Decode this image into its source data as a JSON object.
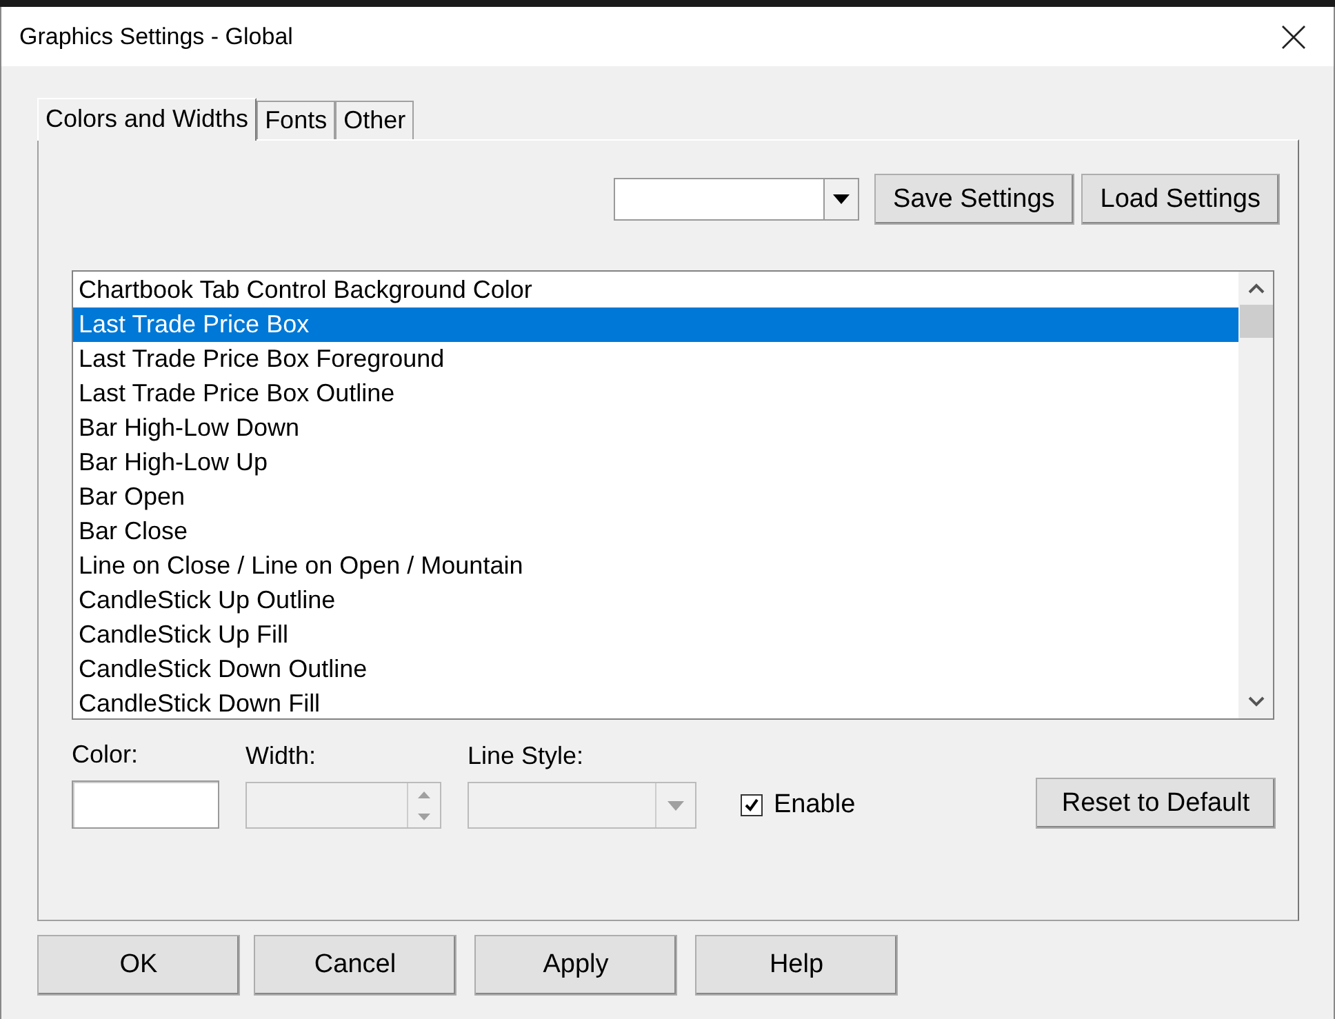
{
  "window": {
    "title": "Graphics Settings - Global"
  },
  "tabs": [
    {
      "label": "Colors and Widths",
      "selected": true
    },
    {
      "label": "Fonts",
      "selected": false
    },
    {
      "label": "Other",
      "selected": false
    }
  ],
  "settings_buttons": [
    "Save Settings",
    "Load Settings"
  ],
  "items": [
    {
      "label": "Chartbook Tab Control Background Color",
      "selected": false
    },
    {
      "label": "Last Trade Price Box",
      "selected": true
    },
    {
      "label": "Last Trade Price Box Foreground",
      "selected": false
    },
    {
      "label": "Last Trade Price Box Outline",
      "selected": false
    },
    {
      "label": "Bar High-Low Down",
      "selected": false
    },
    {
      "label": "Bar High-Low Up",
      "selected": false
    },
    {
      "label": "Bar Open",
      "selected": false
    },
    {
      "label": "Bar Close",
      "selected": false
    },
    {
      "label": "Line on Close / Line on Open / Mountain",
      "selected": false
    },
    {
      "label": "CandleStick Up Outline",
      "selected": false
    },
    {
      "label": "CandleStick Up Fill",
      "selected": false
    },
    {
      "label": "CandleStick Down Outline",
      "selected": false
    },
    {
      "label": "CandleStick Down Fill",
      "selected": false
    }
  ],
  "fields": [
    {
      "kind": "swatch",
      "label": "Color:",
      "disabled": false
    },
    {
      "kind": "spin",
      "label": "Width:",
      "disabled": true
    },
    {
      "kind": "dropdown",
      "label": "Line Style:",
      "disabled": true
    }
  ],
  "enable": {
    "label": "Enable",
    "checked": true
  },
  "reset_button": "Reset to Default",
  "buttons": [
    "OK",
    "Cancel",
    "Apply",
    "Help"
  ]
}
